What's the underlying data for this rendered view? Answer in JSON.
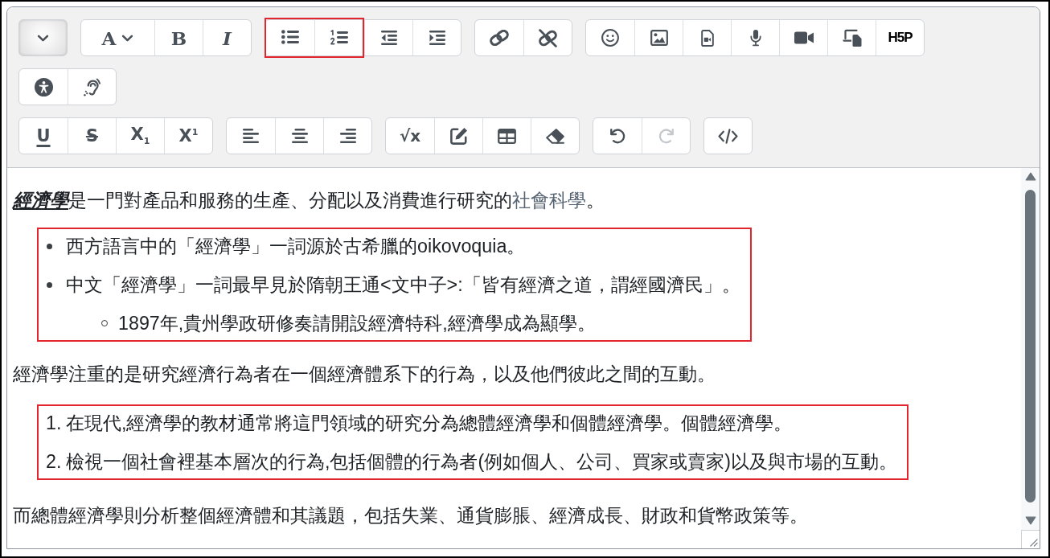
{
  "toolbar": {
    "toggle": {
      "expanded": true
    },
    "rows": [
      {
        "groups": [
          {
            "buttons": [
              {
                "kind": "font",
                "label": "A",
                "disabled": false,
                "highlighted": false
              },
              {
                "kind": "bold",
                "label": "B",
                "disabled": false,
                "highlighted": false
              },
              {
                "kind": "italic",
                "label": "I",
                "disabled": false,
                "highlighted": false
              }
            ]
          },
          {
            "buttons": [
              {
                "kind": "bullet-list",
                "disabled": false,
                "highlighted": true
              },
              {
                "kind": "numbered-list",
                "disabled": false,
                "highlighted": true
              },
              {
                "kind": "outdent",
                "disabled": false,
                "highlighted": false
              },
              {
                "kind": "indent",
                "disabled": false,
                "highlighted": false
              }
            ]
          },
          {
            "buttons": [
              {
                "kind": "link",
                "disabled": false,
                "highlighted": false
              },
              {
                "kind": "unlink",
                "disabled": false,
                "highlighted": false
              }
            ]
          },
          {
            "buttons": [
              {
                "kind": "emoji",
                "disabled": false,
                "highlighted": false
              },
              {
                "kind": "image",
                "disabled": false,
                "highlighted": false
              },
              {
                "kind": "media",
                "disabled": false,
                "highlighted": false
              },
              {
                "kind": "record-audio",
                "disabled": false,
                "highlighted": false
              },
              {
                "kind": "record-video",
                "disabled": false,
                "highlighted": false
              },
              {
                "kind": "manage-files",
                "disabled": false,
                "highlighted": false
              },
              {
                "kind": "h5p",
                "label": "H5P",
                "disabled": false,
                "highlighted": false
              }
            ]
          }
        ]
      },
      {
        "groups": [
          {
            "buttons": [
              {
                "kind": "accessibility-checker",
                "disabled": false,
                "highlighted": false
              },
              {
                "kind": "screen-reader-helper",
                "disabled": false,
                "highlighted": false
              }
            ]
          }
        ]
      },
      {
        "groups": [
          {
            "buttons": [
              {
                "kind": "underline",
                "label": "U",
                "disabled": false,
                "highlighted": false
              },
              {
                "kind": "strikethrough",
                "label": "S",
                "disabled": false,
                "highlighted": false
              },
              {
                "kind": "subscript",
                "label": "X$_{1}$",
                "disabled": false,
                "highlighted": false
              },
              {
                "kind": "superscript",
                "label": "X$^{1}$",
                "disabled": false,
                "highlighted": false
              }
            ]
          },
          {
            "buttons": [
              {
                "kind": "align-left",
                "disabled": false,
                "highlighted": false
              },
              {
                "kind": "align-center",
                "disabled": false,
                "highlighted": false
              },
              {
                "kind": "align-right",
                "disabled": false,
                "highlighted": false
              }
            ]
          },
          {
            "buttons": [
              {
                "kind": "equation",
                "label": "√x",
                "disabled": false,
                "highlighted": false
              },
              {
                "kind": "edit",
                "disabled": false,
                "highlighted": false
              },
              {
                "kind": "table",
                "disabled": false,
                "highlighted": false
              },
              {
                "kind": "clear-formatting",
                "disabled": false,
                "highlighted": false
              }
            ]
          },
          {
            "buttons": [
              {
                "kind": "undo",
                "disabled": false,
                "highlighted": false
              },
              {
                "kind": "redo",
                "disabled": true,
                "highlighted": false
              }
            ]
          },
          {
            "buttons": [
              {
                "kind": "source-code",
                "disabled": false,
                "highlighted": false
              }
            ]
          }
        ]
      }
    ]
  },
  "content": {
    "blocks": [
      {
        "kind": "paragraph",
        "highlighted": false,
        "segments": [
          {
            "kind": "term",
            "text": "經濟學"
          },
          {
            "kind": "plain",
            "text": "是一門對產品和服務的生產、分配以及消費進行研究的"
          },
          {
            "kind": "link",
            "text": "社會科學"
          },
          {
            "kind": "plain",
            "text": "。"
          }
        ]
      },
      {
        "kind": "bullet-list",
        "highlighted": true,
        "items": [
          {
            "text": "西方語言中的「經濟學」一詞源於古希臘的oikovoquia。"
          },
          {
            "text": "中文「經濟學」一詞最早見於隋朝王通<文中子>:「皆有經濟之道，謂經國濟民」。",
            "children": [
              {
                "text": "1897年,貴州學政研修奏請開設經濟特科,經濟學成為顯學。"
              }
            ]
          }
        ]
      },
      {
        "kind": "paragraph",
        "highlighted": false,
        "segments": [
          {
            "kind": "plain",
            "text": "經濟學注重的是研究經濟行為者在一個經濟體系下的行為，以及他們彼此之間的互動。"
          }
        ]
      },
      {
        "kind": "numbered-list",
        "highlighted": true,
        "items": [
          {
            "number": "1.",
            "text": "在現代,經濟學的教材通常將這門領域的研究分為總體經濟學和個體經濟學。個體經濟學。"
          },
          {
            "number": "2.",
            "text": "檢視一個社會裡基本層次的行為,包括個體的行為者(例如個人、公司、買家或賣家)以及與市場的互動。"
          }
        ]
      },
      {
        "kind": "paragraph",
        "highlighted": false,
        "segments": [
          {
            "kind": "plain",
            "text": "而總體經濟學則分析整個經濟體和其議題，包括失業、通貨膨脹、經濟成長、財政和貨幣政策等。"
          }
        ]
      }
    ]
  }
}
